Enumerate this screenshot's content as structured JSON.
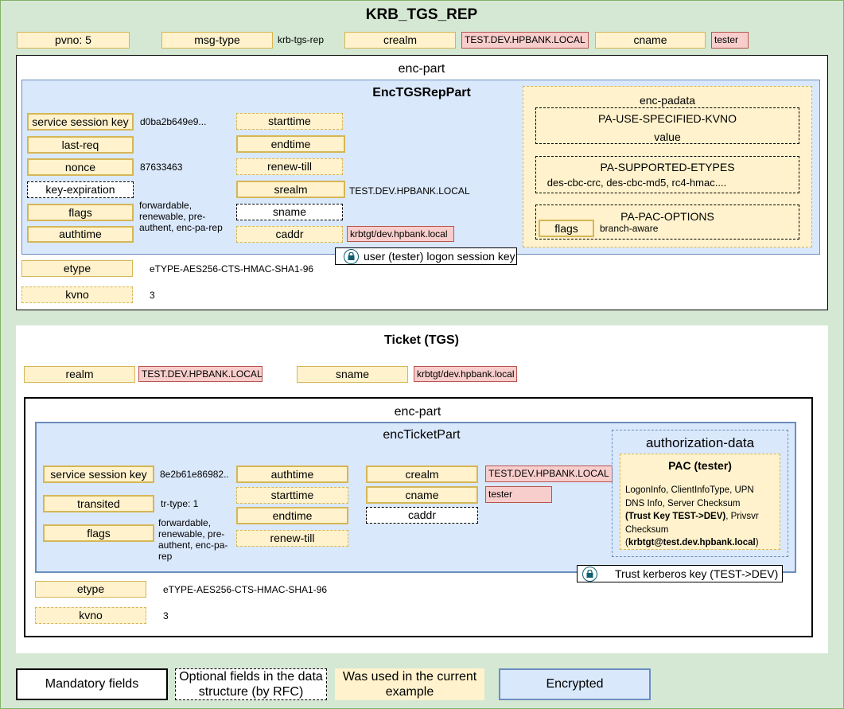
{
  "title": "KRB_TGS_REP",
  "top": {
    "pvno": "pvno: 5",
    "msg_type": "msg-type",
    "msg_type_value": "krb-tgs-rep",
    "crealm": "crealm",
    "crealm_value": "TEST.DEV.HPBANK.LOCAL",
    "cname": "cname",
    "cname_value": "tester"
  },
  "enc_part": {
    "title": "enc-part",
    "rep_part": {
      "title": "EncTGSRepPart",
      "service_session_key": "service session key",
      "service_session_key_value": "d0ba2b649e9...",
      "last_req": "last-req",
      "nonce": "nonce",
      "nonce_value": "87633463",
      "key_expiration": "key-expiration",
      "flags": "flags",
      "flags_value": "forwardable, renewable, pre-authent, enc-pa-rep",
      "authtime": "authtime",
      "starttime": "starttime",
      "endtime": "endtime",
      "renew_till": "renew-till",
      "srealm": "srealm",
      "srealm_value": "TEST.DEV.HPBANK.LOCAL",
      "sname": "sname",
      "caddr": "caddr",
      "caddr_value": "krbtgt/dev.hpbank.local",
      "padata": {
        "title": "enc-padata",
        "kvno_title": "PA-USE-SPECIFIED-KVNO",
        "kvno_value": "value",
        "etypes_title": "PA-SUPPORTED-ETYPES",
        "etypes_value": "des-cbc-crc, des-cbc-md5, rc4-hmac....",
        "pac_title": "PA-PAC-OPTIONS",
        "pac_flags": "flags",
        "pac_flags_value": "branch-aware"
      },
      "lock_label": "user (tester) logon session key"
    },
    "etype": "etype",
    "etype_value": "eTYPE-AES256-CTS-HMAC-SHA1-96",
    "kvno": "kvno",
    "kvno_value": "3"
  },
  "ticket": {
    "title": "Ticket (TGS)",
    "realm": "realm",
    "realm_value": "TEST.DEV.HPBANK.LOCAL",
    "sname": "sname",
    "sname_value": "krbtgt/dev.hpbank.local",
    "enc_part": {
      "title": "enc-part",
      "ticket_part": {
        "title": "encTicketPart",
        "service_session_key": "service session key",
        "service_session_key_value": "8e2b61e86982..",
        "transited": "transited",
        "transited_value": "tr-type: 1",
        "flags": "flags",
        "flags_value": "forwardable, renewable, pre-authent, enc-pa-rep",
        "authtime": "authtime",
        "starttime": "starttime",
        "endtime": "endtime",
        "renew_till": "renew-till",
        "crealm": "crealm",
        "crealm_value": "TEST.DEV.HPBANK.LOCAL",
        "cname": "cname",
        "cname_value": "tester",
        "caddr": "caddr",
        "authz": {
          "title": "authorization-data",
          "pac_title": "PAC (tester)",
          "pac_line1": "LogonInfo, ClientInfoType, UPN",
          "pac_line2": "DNS Info, Server Checksum",
          "pac_line3_bold": "(Trust Key TEST->DEV)",
          "pac_line3_rest": ",  Privsvr",
          "pac_line4": "Checksum",
          "pac_line5_open": "(",
          "pac_line5_bold": "krbtgt@test.dev.hpbank.local",
          "pac_line5_close": ")"
        },
        "lock_label": "Trust kerberos key (TEST->DEV)"
      },
      "etype": "etype",
      "etype_value": "eTYPE-AES256-CTS-HMAC-SHA1-96",
      "kvno": "kvno",
      "kvno_value": "3"
    }
  },
  "legend": {
    "mandatory": "Mandatory fields",
    "optional": "Optional fields in the data structure (by RFC)",
    "used": "Was used in the current example",
    "encrypted": "Encrypted"
  },
  "colors": {
    "background": "#d5e8d4",
    "used_fill": "#fff2cc",
    "used_border": "#d6b656",
    "value_fill": "#f8cecc",
    "value_border": "#b85450",
    "encrypted_fill": "#dae8fc",
    "encrypted_border": "#6c8ebf",
    "lock_color": "#0e5e6f"
  }
}
